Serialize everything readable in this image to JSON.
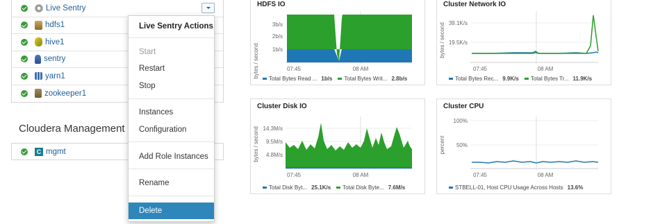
{
  "services": [
    {
      "name": "Live Sentry",
      "icon": "live-sentry-icon",
      "status": "good"
    },
    {
      "name": "hdfs1",
      "icon": "hdfs-icon",
      "status": "good"
    },
    {
      "name": "hive1",
      "icon": "hive-icon",
      "status": "good"
    },
    {
      "name": "sentry",
      "icon": "sentry-icon",
      "status": "good"
    },
    {
      "name": "yarn1",
      "icon": "yarn-icon",
      "status": "good"
    },
    {
      "name": "zookeeper1",
      "icon": "zookeeper-icon",
      "status": "good"
    }
  ],
  "mgmt": {
    "title": "Cloudera Management Se",
    "service": "mgmt",
    "logo_letter": "C"
  },
  "menu": {
    "header": "Live Sentry Actions",
    "start": "Start",
    "restart": "Restart",
    "stop": "Stop",
    "instances": "Instances",
    "configuration": "Configuration",
    "add_role_instances": "Add Role Instances",
    "rename": "Rename",
    "delete": "Delete"
  },
  "colors": {
    "accent_blue": "#2f86bb",
    "series_blue": "#1f77b4",
    "series_green": "#2ca02c",
    "status_green": "#3a9a3a"
  },
  "charts": [
    {
      "id": "hdfs-io",
      "title": "HDFS IO",
      "ylabel": "bytes / second",
      "yticks": [
        "3b/s",
        "2b/s",
        "1b/s"
      ],
      "xticks": [
        "07:45",
        "08 AM"
      ],
      "legend": [
        {
          "name": "Total Bytes Read ...",
          "value": "1b/s",
          "color": "#1f77b4"
        },
        {
          "name": "Total Bytes Writ...",
          "value": "2.8b/s",
          "color": "#2ca02c"
        }
      ]
    },
    {
      "id": "cluster-network-io",
      "title": "Cluster Network IO",
      "ylabel": "bytes / second",
      "yticks": [
        "39.1K/s",
        "19.5K/s"
      ],
      "xticks": [
        "07:45",
        "08 AM"
      ],
      "legend": [
        {
          "name": "Total Bytes Rec...",
          "value": "9.9K/s",
          "color": "#1f77b4"
        },
        {
          "name": "Total Bytes Tr...",
          "value": "11.9K/s",
          "color": "#2ca02c"
        }
      ]
    },
    {
      "id": "cluster-disk-io",
      "title": "Cluster Disk IO",
      "ylabel": "bytes / second",
      "yticks": [
        "14.3M/s",
        "9.5M/s",
        "4.8M/s"
      ],
      "xticks": [
        "07:45",
        "08 AM"
      ],
      "legend": [
        {
          "name": "Total Disk Byt...",
          "value": "25.1K/s",
          "color": "#1f77b4"
        },
        {
          "name": "Total Disk Byte...",
          "value": "7.6M/s",
          "color": "#2ca02c"
        }
      ]
    },
    {
      "id": "cluster-cpu",
      "title": "Cluster CPU",
      "ylabel": "percent",
      "yticks": [
        "100%",
        "50%"
      ],
      "xticks": [
        "07:45",
        "08 AM"
      ],
      "legend": [
        {
          "name": "STBELL-01, Host CPU Usage Across Hosts",
          "value": "13.6%",
          "color": "#1f77b4"
        }
      ]
    }
  ]
}
